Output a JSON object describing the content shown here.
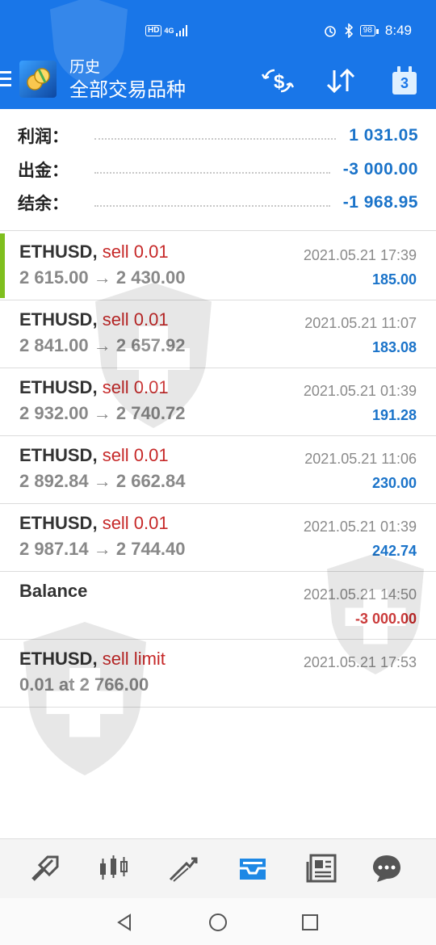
{
  "status": {
    "net": "HD",
    "net2": "4G",
    "battery": "98",
    "time": "8:49"
  },
  "header": {
    "subtitle": "历史",
    "title": "全部交易品种",
    "calendar_day": "3"
  },
  "summary": [
    {
      "label": "利润：",
      "value": "1 031.05"
    },
    {
      "label": "出金：",
      "value": "-3 000.00"
    },
    {
      "label": "结余：",
      "value": "-1 968.95"
    }
  ],
  "deals": [
    {
      "symbol": "ETHUSD,",
      "type": "sell 0.01",
      "prices": "2 615.00 → 2 430.00",
      "time": "2021.05.21 17:39",
      "profit": "185.00"
    },
    {
      "symbol": "ETHUSD,",
      "type": "sell 0.01",
      "prices": "2 841.00 → 2 657.92",
      "time": "2021.05.21 11:07",
      "profit": "183.08"
    },
    {
      "symbol": "ETHUSD,",
      "type": "sell 0.01",
      "prices": "2 932.00 → 2 740.72",
      "time": "2021.05.21 01:39",
      "profit": "191.28"
    },
    {
      "symbol": "ETHUSD,",
      "type": "sell 0.01",
      "prices": "2 892.84 → 2 662.84",
      "time": "2021.05.21 11:06",
      "profit": "230.00"
    },
    {
      "symbol": "ETHUSD,",
      "type": "sell 0.01",
      "prices": "2 987.14 → 2 744.40",
      "time": "2021.05.21 01:39",
      "profit": "242.74"
    },
    {
      "symbol": "Balance",
      "type": "",
      "prices": "",
      "time": "2021.05.21 14:50",
      "profit": "-3 000.00"
    },
    {
      "symbol": "ETHUSD,",
      "type": "sell limit",
      "prices": "0.01 at 2 766.00",
      "time": "2021.05.21 17:53",
      "profit": ""
    }
  ],
  "colors": {
    "appbar": "#1976e8",
    "profit_positive": "#1a73c9",
    "profit_negative": "#c62828",
    "accent": "#7fbf1e"
  },
  "bottom_nav": [
    "quotes-icon",
    "chart-icon",
    "trade-icon",
    "history-icon",
    "news-icon",
    "chat-icon"
  ]
}
